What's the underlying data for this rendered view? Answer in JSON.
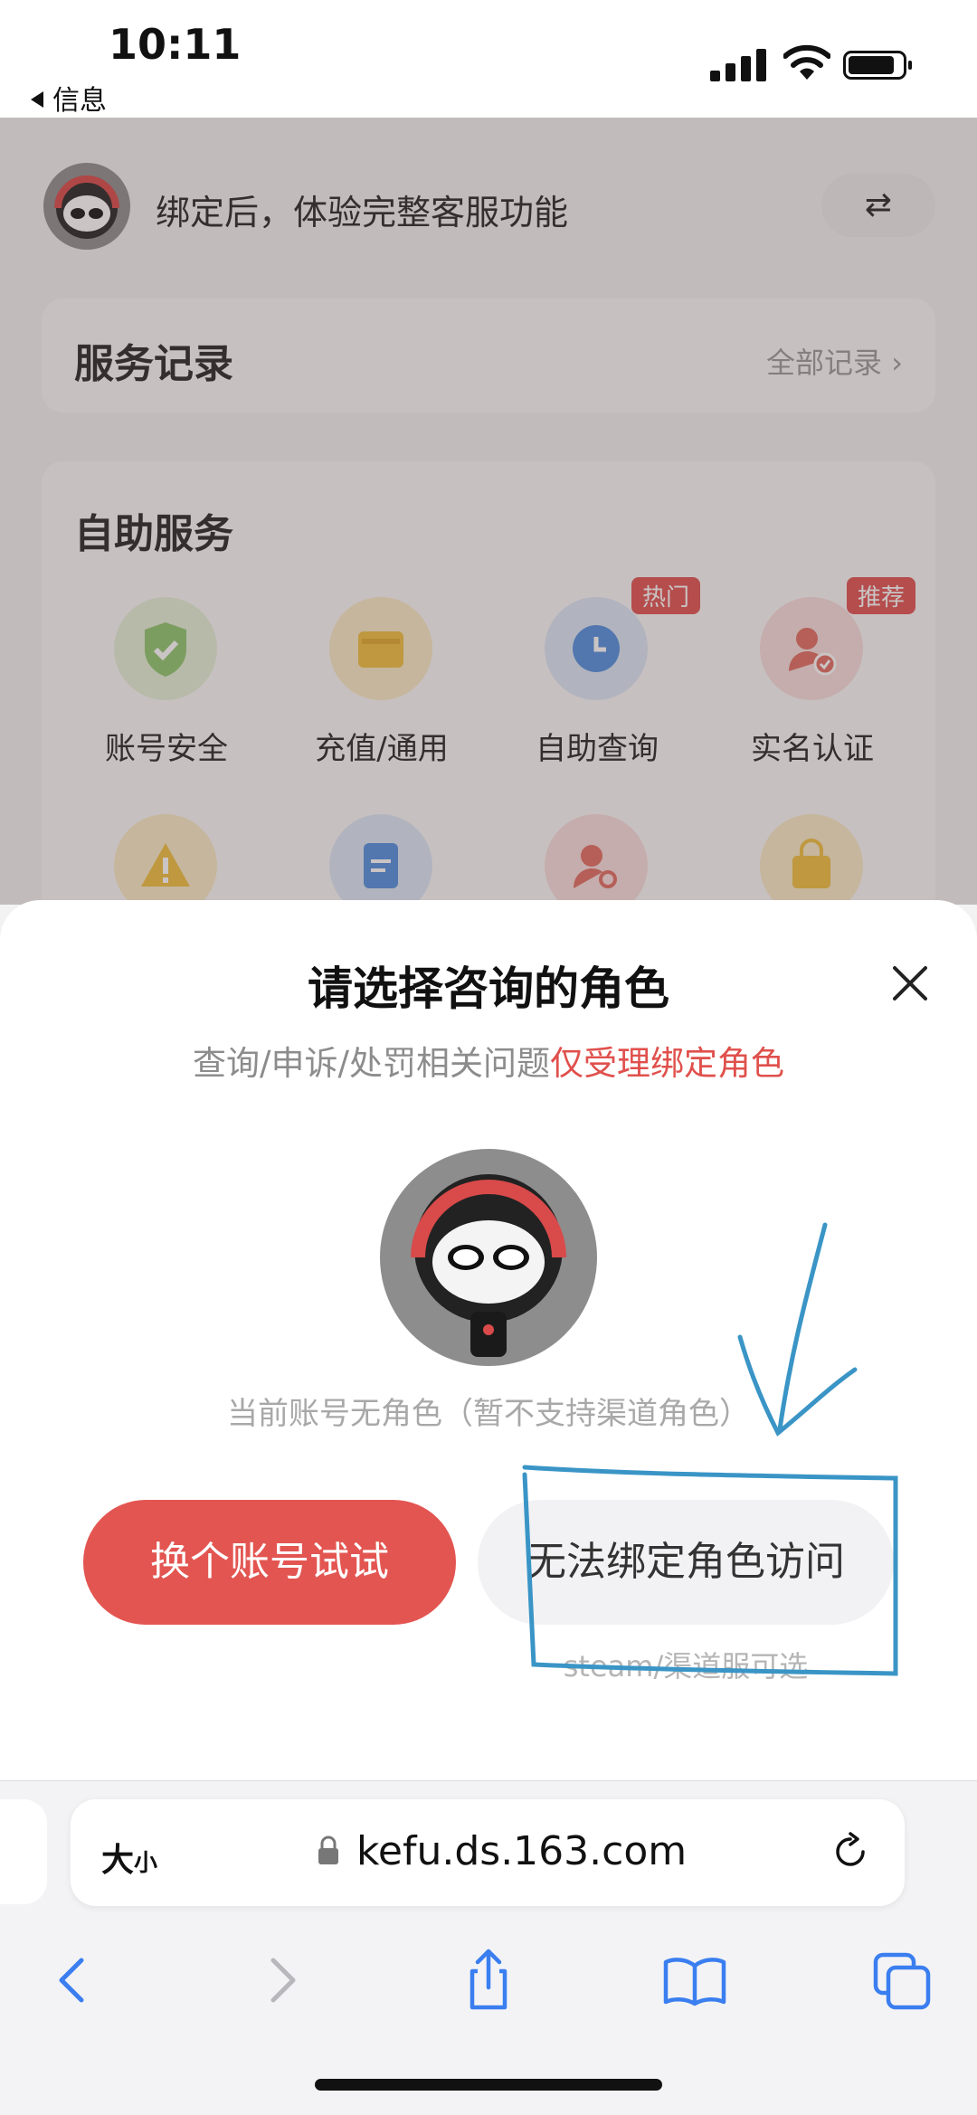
{
  "status": {
    "time": "10:11",
    "back_app": "信息"
  },
  "page": {
    "bind_tip": "绑定后，体验完整客服功能",
    "switch_label": "⇄",
    "records": {
      "title": "服务记录",
      "more": "全部记录 ›"
    },
    "self_service": {
      "title": "自助服务",
      "items": [
        {
          "label": "账号安全",
          "color": "#9ccf84"
        },
        {
          "label": "充值/通用",
          "color": "#f2c548"
        },
        {
          "label": "自助查询",
          "color": "#5c9ae8",
          "badge": "热门"
        },
        {
          "label": "实名认证",
          "color": "#ea7c72",
          "badge": "推荐"
        }
      ]
    }
  },
  "sheet": {
    "title": "请选择咨询的角色",
    "subtitle_gray": "查询/申诉/处罚相关问题",
    "subtitle_red": "仅受理绑定角色",
    "no_role": "当前账号无角色（暂不支持渠道角色）",
    "btn_switch_account": "换个账号试试",
    "btn_unbind_access": "无法绑定角色访问",
    "steam_tip": "steam/渠道服可选"
  },
  "browser": {
    "text_size": "大",
    "text_size_small": "小",
    "url": "kefu.ds.163.com"
  },
  "colors": {
    "accent_red": "#e35551",
    "annotation_blue": "#3a95c6"
  }
}
